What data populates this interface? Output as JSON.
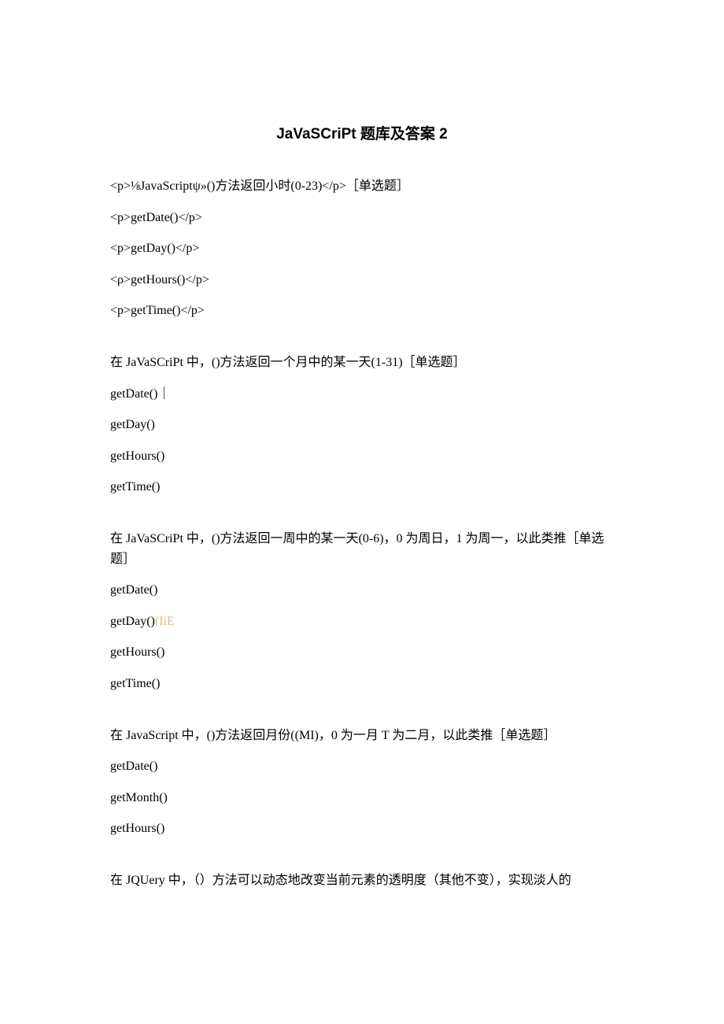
{
  "title": "JaVaSCriPt 题库及答案 2",
  "q1": {
    "stem": "<p>⅛JavaScriptψ»()方法返回小时(0-23)</p>［单选题］",
    "opts": [
      "<p>getDate()</p>",
      "<p>getDay()</p>",
      "<ρ>getHours()</p>",
      "<p>getTime()</p>"
    ]
  },
  "q2": {
    "stem": "在 JaVaSCriPt 中，()方法返回一个月中的某一天(1-31)［单选题］",
    "opts": [
      "getDate()｜",
      "getDay()",
      "getHours()",
      "getTime()"
    ]
  },
  "q3": {
    "stem": "在 JaVaSCriPt 中，()方法返回一周中的某一天(0-6)，0 为周日，1 为周一，以此类推［单选题］",
    "opts_a": "getDate()",
    "opts_b_prefix": "getDay()",
    "opts_b_marker": "(IiE",
    "opts_c": "getHours()",
    "opts_d": "getTime()"
  },
  "q4": {
    "stem": "在 JavaScript 中，()方法返回月份((MI)，0 为一月 T 为二月，以此类推［单选题］",
    "opts": [
      "getDate()",
      "getMonth()",
      "getHours()"
    ]
  },
  "q5": {
    "stem": "在 JQUery 中，（）方法可以动态地改变当前元素的透明度（其他不变），实现淡人的"
  }
}
